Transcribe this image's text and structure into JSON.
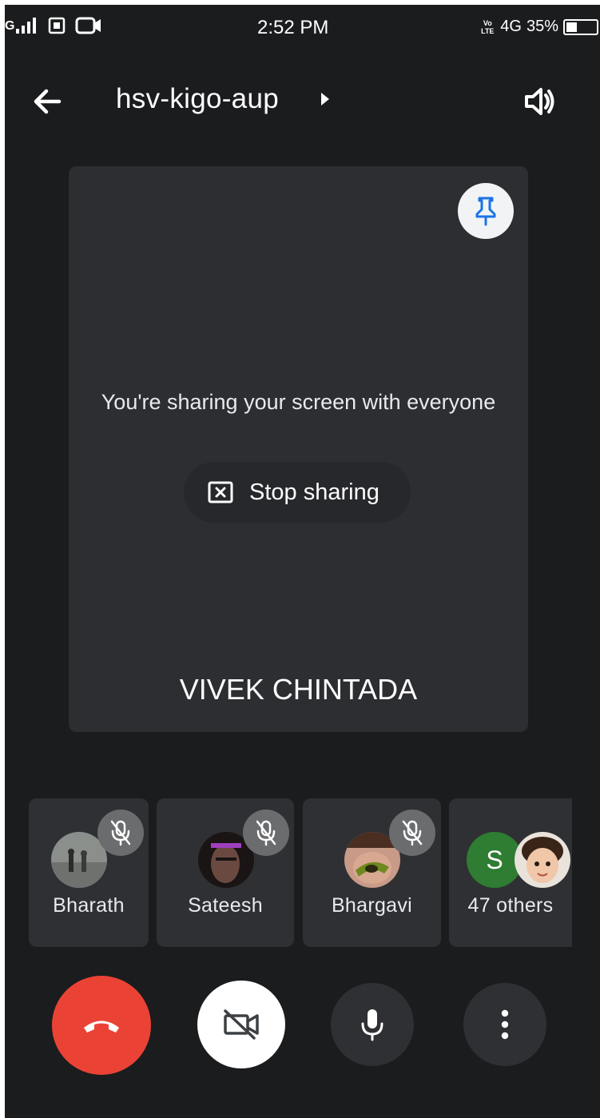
{
  "status_bar": {
    "network": "G",
    "time": "2:52 PM",
    "volte": "Vo LTE",
    "network_type": "4G",
    "battery": "35%",
    "battery_level": 0.35
  },
  "header": {
    "meeting_code": "hsv-kigo-aup"
  },
  "main_tile": {
    "message": "You're sharing your screen with everyone",
    "stop_sharing_label": "Stop sharing",
    "presenter_name": "VIVEK CHINTADA"
  },
  "participants": [
    {
      "name": "Bharath",
      "muted": true
    },
    {
      "name": "Sateesh",
      "muted": true
    },
    {
      "name": "Bhargavi",
      "muted": true
    }
  ],
  "others": {
    "label": "47 others",
    "initial": "S"
  },
  "icons": {
    "back": "arrow-left-icon",
    "speaker": "speaker-icon",
    "pin": "pin-icon",
    "stop": "stop-share-icon",
    "mic_off": "mic-off-icon",
    "end_call": "end-call-icon",
    "camera_off": "camera-off-icon",
    "mic": "mic-icon",
    "more": "more-vert-icon"
  },
  "colors": {
    "end_call": "#ea4335",
    "pin": "#1a73e8",
    "avatar_s": "#2e7d32"
  }
}
